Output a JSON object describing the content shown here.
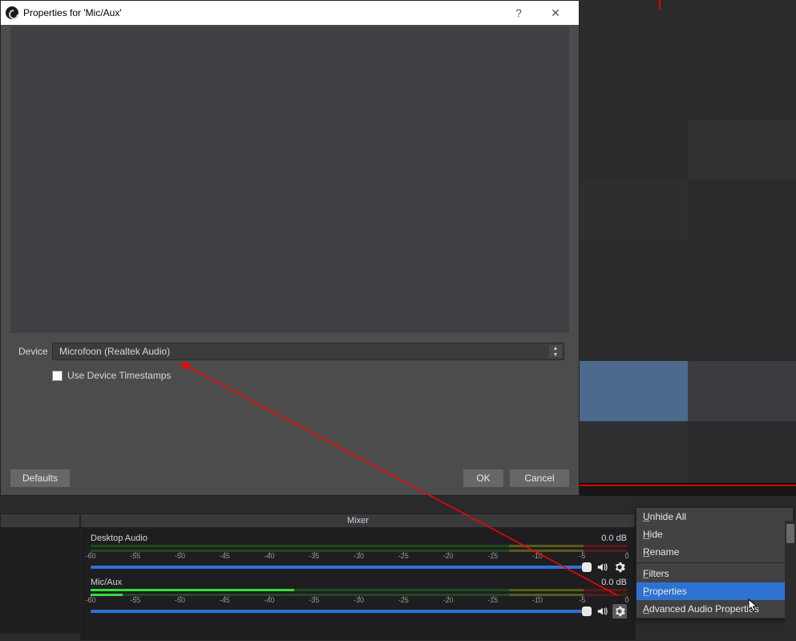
{
  "dialog": {
    "title": "Properties for 'Mic/Aux'",
    "help_glyph": "?",
    "close_glyph": "✕",
    "device_label": "Device",
    "device_value": "Microfoon (Realtek Audio)",
    "use_timestamps_label": "Use Device Timestamps",
    "use_timestamps_checked": false,
    "defaults_label": "Defaults",
    "ok_label": "OK",
    "cancel_label": "Cancel"
  },
  "mixer": {
    "title": "Mixer",
    "scale_ticks": [
      -60,
      -55,
      -50,
      -45,
      -40,
      -35,
      -30,
      -25,
      -20,
      -15,
      -10,
      -5,
      0
    ],
    "channels": [
      {
        "name": "Desktop Audio",
        "db": "0.0 dB",
        "level_green_end": 0.78,
        "level_yellow_end": 0.92,
        "level_red_end": 1.0,
        "fill_a": 0.0,
        "fill_b": 0.0,
        "slider": 1.0,
        "gear_active": false
      },
      {
        "name": "Mic/Aux",
        "db": "0.0 dB",
        "level_green_end": 0.78,
        "level_yellow_end": 0.92,
        "level_red_end": 1.0,
        "fill_a": 0.38,
        "fill_b": 0.06,
        "slider": 1.0,
        "gear_active": true
      }
    ]
  },
  "context_menu": {
    "items": [
      {
        "label": "Unhide All",
        "accel": "U",
        "selected": false
      },
      {
        "label": "Hide",
        "accel": "H",
        "selected": false
      },
      {
        "label": "Rename",
        "accel": "R",
        "selected": false
      },
      {
        "sep": true
      },
      {
        "label": "Filters",
        "accel": "F",
        "selected": false
      },
      {
        "label": "Properties",
        "accel": "P",
        "selected": true
      },
      {
        "label": "Advanced Audio Properties",
        "accel": "A",
        "selected": false
      }
    ]
  },
  "background_tiles": {
    "rows": [
      [
        "#2b2b2e",
        "#2b2b2e"
      ],
      [
        "#2b2b2e",
        "#2b2b2e"
      ],
      [
        "#2b2b2e",
        "#313134"
      ],
      [
        "#2e2e31",
        "#2b2b2e"
      ],
      [
        "#2b2b2e",
        "#2b2b2e"
      ],
      [
        "#2b2b2e",
        "#2b2b2e"
      ],
      [
        "#4b6a8c",
        "#3c3c40"
      ],
      [
        "#303033",
        "#2b2b2e"
      ]
    ]
  }
}
